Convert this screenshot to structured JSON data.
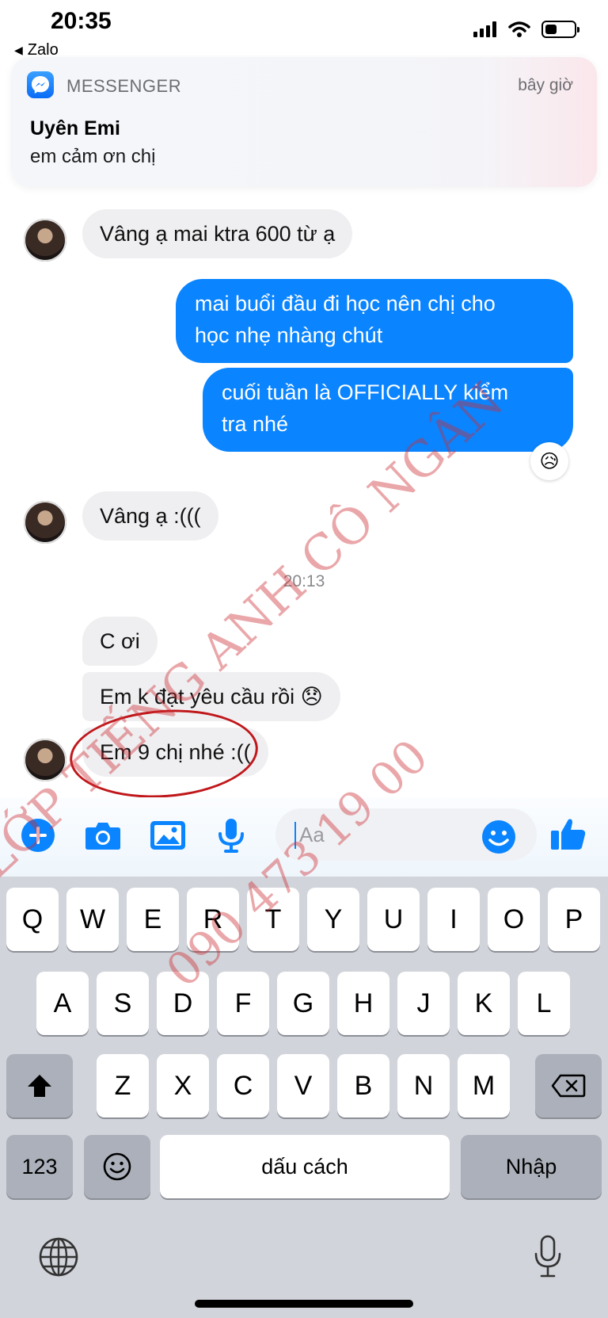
{
  "status_bar": {
    "time": "20:35",
    "back_app": "Zalo"
  },
  "notification": {
    "app_name": "MESSENGER",
    "time": "bây giờ",
    "sender": "Uyên Emi",
    "message": "em cảm ơn chị"
  },
  "messages": [
    {
      "dir": "in",
      "text": "Vâng ạ mai ktra 600 từ ạ"
    },
    {
      "dir": "out",
      "line1": "mai buổi đầu đi học nên chị cho",
      "line2": "học nhẹ nhàng chút"
    },
    {
      "dir": "out",
      "line1": "cuối tuần là OFFICIALLY kiểm",
      "line2": "tra nhé",
      "reaction": "😥"
    },
    {
      "dir": "in",
      "text": "Vâng ạ :((("
    },
    {
      "dir": "in",
      "text": "C ơi"
    },
    {
      "dir": "in",
      "text": "Em k đạt yêu cầu rồi 😞"
    },
    {
      "dir": "in",
      "text": "Em 9 chị nhé :(("
    }
  ],
  "timestamp": "20:13",
  "composer": {
    "placeholder": "Aa"
  },
  "keyboard": {
    "row1": [
      "Q",
      "W",
      "E",
      "R",
      "T",
      "Y",
      "U",
      "I",
      "O",
      "P"
    ],
    "row2": [
      "A",
      "S",
      "D",
      "F",
      "G",
      "H",
      "J",
      "K",
      "L"
    ],
    "row3": [
      "Z",
      "X",
      "C",
      "V",
      "B",
      "N",
      "M"
    ],
    "numbers_key": "123",
    "space_key": "dấu cách",
    "return_key": "Nhập"
  },
  "watermark": {
    "line1": "LỚP TIẾNG ANH CÔ NGÂN",
    "line2": "090 473 19 00"
  },
  "colors": {
    "accent": "#0a84ff",
    "incoming_bubble": "#efeff1",
    "annotation_circle": "#c0171b",
    "watermark": "#ce2e34"
  }
}
